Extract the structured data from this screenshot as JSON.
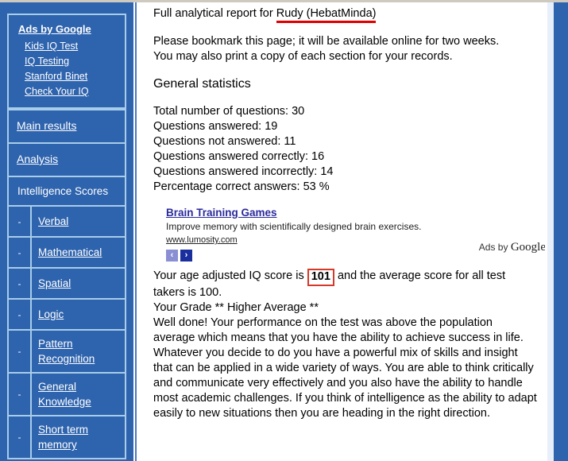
{
  "sidebar": {
    "ads_box": {
      "title": "Ads by Google",
      "links": [
        "Kids IQ Test",
        "IQ Testing",
        "Stanford Binet",
        "Check Your IQ"
      ]
    },
    "nav": [
      "Main results",
      "Analysis"
    ],
    "section_title": "Intelligence Scores",
    "dash": "-",
    "subitems": [
      "Verbal",
      "Mathematical",
      "Spatial",
      "Logic",
      "Pattern Recognition",
      "General Knowledge",
      "Short term memory"
    ]
  },
  "content": {
    "report_title_prefix": "Full analytical report for ",
    "report_subject": "Rudy (HebatMinda)",
    "bookmark_line1": "Please bookmark this page; it will be available online for two weeks.",
    "bookmark_line2": "You may also print a copy of each section for your records.",
    "general_statistics_heading": "General statistics",
    "stats": [
      "Total number of questions: 30",
      "Questions answered: 19",
      "Questions not answered: 11",
      "Questions answered correctly: 16",
      "Questions answered incorrectly: 14",
      "Percentage correct answers: 53 %"
    ],
    "ad": {
      "title": "Brain Training Games",
      "description": "Improve memory with scientifically designed brain exercises.",
      "url": "www.lumosity.com",
      "prev_arrow": "‹",
      "next_arrow": "›",
      "byline_prefix": "Ads by ",
      "byline_brand": "Google"
    },
    "score_text_before": "Your age adjusted IQ score is ",
    "score_value": "101",
    "score_text_after": " and the average score for all test takers is 100.",
    "grade_line": "Your Grade ** Higher Average **",
    "final_paragraph": "Well done! Your performance on the test was above the population average which means that you have the ability to achieve success in life. Whatever you decide to do you have a powerful mix of skills and insight that can be applied in a wide variety of ways. You are able to think critically and communicate very effectively and you also have the ability to handle most academic challenges. If you think of intelligence as the ability to adapt easily to new situations then you are heading in the right direction."
  },
  "colors": {
    "sidebar_background": "#2e63ad",
    "sidebar_border": "#a8cdea",
    "ad_link": "#2a2a9c",
    "highlight_border": "#d33a2a",
    "red_underline": "#e00000"
  }
}
